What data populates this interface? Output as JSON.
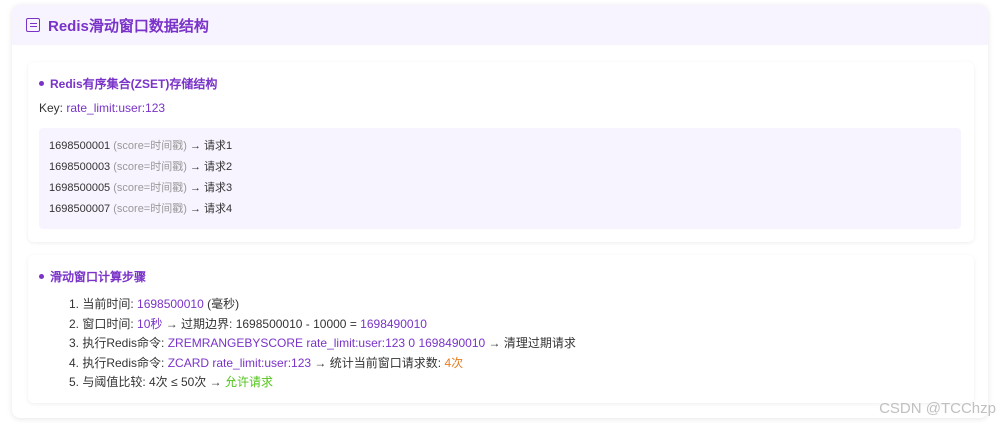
{
  "card": {
    "title": "Redis滑动窗口数据结构"
  },
  "section1": {
    "title": "Redis有序集合(ZSET)存储结构",
    "key_label": "Key: ",
    "key_value": "rate_limit:user:123",
    "rows": [
      {
        "score": "1698500001",
        "note": "(score=时间戳)",
        "member": "→ 请求1"
      },
      {
        "score": "1698500003",
        "note": "(score=时间戳)",
        "member": "→ 请求2"
      },
      {
        "score": "1698500005",
        "note": "(score=时间戳)",
        "member": "→ 请求3"
      },
      {
        "score": "1698500007",
        "note": "(score=时间戳)",
        "member": "→ 请求4"
      }
    ]
  },
  "section2": {
    "title": "滑动窗口计算步骤",
    "steps": [
      {
        "a": "1. 当前时间: ",
        "b": "1698500010",
        "c": " (毫秒)"
      },
      {
        "a": "2. 窗口时间: ",
        "b": "10秒",
        "c": " → 过期边界: 1698500010 - 10000 = ",
        "d": "1698490010"
      },
      {
        "a": "3. 执行Redis命令: ",
        "b": "ZREMRANGEBYSCORE rate_limit:user:123 0 1698490010",
        "c": " → 清理过期请求"
      },
      {
        "a": "4. 执行Redis命令: ",
        "b": "ZCARD rate_limit:user:123",
        "c": " → 统计当前窗口请求数: ",
        "d": "4次"
      },
      {
        "a": "5. 与阈值比较: 4次 ≤ 50次 → ",
        "b": "允许请求"
      }
    ]
  },
  "watermark": "CSDN @TCChzp",
  "colors": {
    "accent": "#7a33c8",
    "header_bg": "#f8f4ff",
    "warning": "#e67e22",
    "success": "#52c41a"
  }
}
